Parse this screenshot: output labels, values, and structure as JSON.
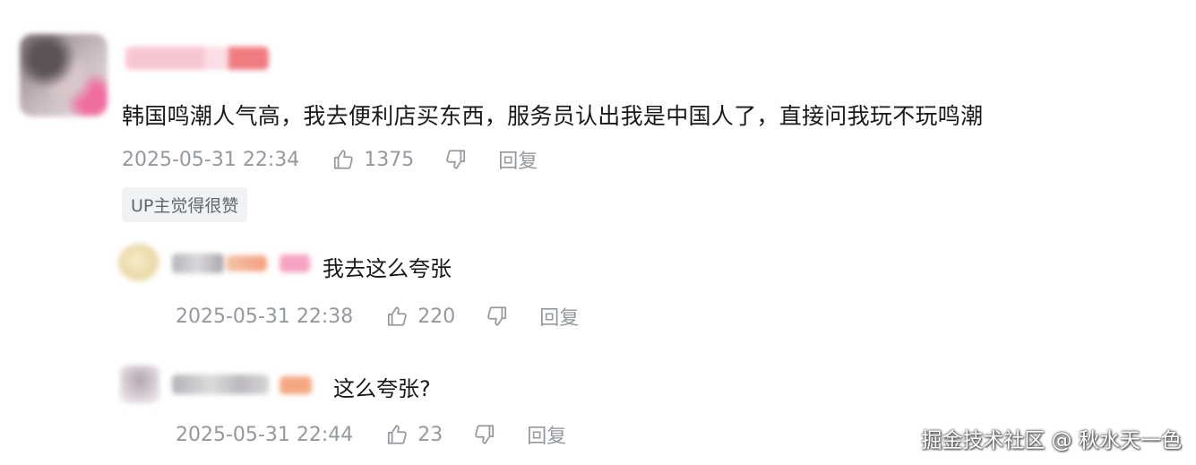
{
  "main_comment": {
    "content": "韩国鸣潮人气高，我去便利店买东西，服务员认出我是中国人了，直接问我玩不玩鸣潮",
    "time": "2025-05-31 22:34",
    "likes": "1375",
    "reply_label": "回复",
    "badge": "UP主觉得很赞"
  },
  "replies": [
    {
      "content": "我去这么夸张",
      "time": "2025-05-31 22:38",
      "likes": "220",
      "reply_label": "回复"
    },
    {
      "content": "这么夸张?",
      "time": "2025-05-31 22:44",
      "likes": "23",
      "reply_label": "回复"
    }
  ],
  "watermark": "掘金技术社区 @ 秋水天一色",
  "colors": {
    "meta_gray": "#9499a0",
    "text": "#18191c",
    "badge_bg": "#f1f2f3"
  },
  "icons": [
    "thumb-up-icon",
    "thumb-down-icon"
  ]
}
